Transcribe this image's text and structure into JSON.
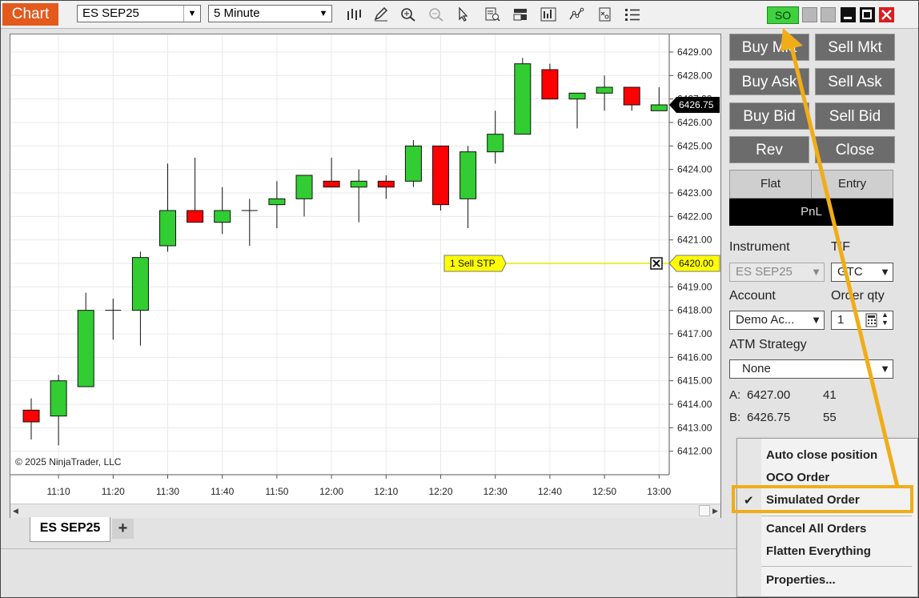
{
  "titlebar": {
    "chart_label": "Chart",
    "instrument": "ES SEP25",
    "interval": "5 Minute",
    "so_label": "SO"
  },
  "icons": [
    "bars-icon",
    "pencil-icon",
    "zoom-in-icon",
    "zoom-out-icon",
    "pointer-icon",
    "data-box-icon",
    "toggle-icon",
    "chart-trader-icon",
    "indicators-icon",
    "strategies-icon",
    "properties-icon",
    "minimize-icon",
    "maximize-icon",
    "close-icon"
  ],
  "chart_data": {
    "type": "candlestick",
    "x": [
      "11:05",
      "11:10",
      "11:15",
      "11:20",
      "11:25",
      "11:30",
      "11:35",
      "11:40",
      "11:45",
      "11:50",
      "11:55",
      "12:00",
      "12:05",
      "12:10",
      "12:15",
      "12:20",
      "12:25",
      "12:30",
      "12:35",
      "12:40",
      "12:45",
      "12:50",
      "12:55",
      "13:00"
    ],
    "x_ticks": [
      "11:10",
      "11:20",
      "11:30",
      "11:40",
      "11:50",
      "12:00",
      "12:10",
      "12:20",
      "12:30",
      "12:40",
      "12:50",
      "13:00"
    ],
    "y_ticks": [
      "6412.00",
      "6413.00",
      "6414.00",
      "6415.00",
      "6416.00",
      "6417.00",
      "6418.00",
      "6419.00",
      "6420.00",
      "6421.00",
      "6422.00",
      "6423.00",
      "6424.00",
      "6425.00",
      "6426.00",
      "6427.00",
      "6428.00",
      "6429.00"
    ],
    "ylim": [
      6411.0,
      6429.75
    ],
    "ohlc": [
      [
        6413.75,
        6414.25,
        6412.5,
        6413.25
      ],
      [
        6413.5,
        6415.25,
        6412.25,
        6415.0
      ],
      [
        6414.75,
        6418.75,
        6414.75,
        6418.0
      ],
      [
        6418.0,
        6418.5,
        6416.75,
        6418.0
      ],
      [
        6418.0,
        6420.5,
        6416.5,
        6420.25
      ],
      [
        6420.75,
        6424.25,
        6420.5,
        6422.25
      ],
      [
        6422.25,
        6424.5,
        6421.75,
        6421.75
      ],
      [
        6421.75,
        6423.25,
        6421.25,
        6422.25
      ],
      [
        6422.25,
        6422.75,
        6420.75,
        6422.25
      ],
      [
        6422.5,
        6423.5,
        6421.5,
        6422.75
      ],
      [
        6422.75,
        6423.75,
        6422.0,
        6423.75
      ],
      [
        6423.5,
        6424.5,
        6423.25,
        6423.25
      ],
      [
        6423.25,
        6424.0,
        6421.75,
        6423.5
      ],
      [
        6423.5,
        6423.75,
        6422.75,
        6423.25
      ],
      [
        6423.5,
        6425.25,
        6423.25,
        6425.0
      ],
      [
        6425.0,
        6425.0,
        6422.25,
        6422.5
      ],
      [
        6422.75,
        6425.0,
        6421.5,
        6424.75
      ],
      [
        6424.75,
        6426.5,
        6424.25,
        6425.5
      ],
      [
        6425.5,
        6428.75,
        6425.5,
        6428.5
      ],
      [
        6428.25,
        6428.5,
        6427.0,
        6427.0
      ],
      [
        6427.0,
        6427.25,
        6425.75,
        6427.25
      ],
      [
        6427.25,
        6428.0,
        6426.5,
        6427.5
      ],
      [
        6427.5,
        6427.5,
        6426.5,
        6426.75
      ],
      [
        6426.5,
        6427.5,
        6426.5,
        6426.75
      ]
    ],
    "last_price": "6426.75",
    "order_price": "6420.00",
    "order_label": "1  Sell STP",
    "copyright": "© 2025 NinjaTrader, LLC",
    "up_color": "#32cd32",
    "down_color": "#ff0000"
  },
  "tabs": {
    "active": "ES SEP25",
    "add": "+"
  },
  "trader": {
    "buttons": [
      "Buy Mkt",
      "Sell Mkt",
      "Buy Ask",
      "Sell Ask",
      "Buy Bid",
      "Sell Bid",
      "Rev",
      "Close"
    ],
    "flat": "Flat",
    "entry": "Entry",
    "pnl": "PnL",
    "instrument_label": "Instrument",
    "instrument_value": "ES SEP25",
    "tif_label": "TIF",
    "tif_value": "GTC",
    "account_label": "Account",
    "account_value": "Demo Ac...",
    "qty_label": "Order qty",
    "qty_value": "1",
    "atm_label": "ATM Strategy",
    "atm_value": "None",
    "ask_label": "A:",
    "ask_price": "6427.00",
    "ask_size": "41",
    "bid_label": "B:",
    "bid_price": "6426.75",
    "bid_size": "55"
  },
  "menu": {
    "items": [
      "Auto close position",
      "OCO Order",
      "Simulated Order",
      "Cancel All Orders",
      "Flatten Everything",
      "Properties..."
    ],
    "checked": "✔"
  },
  "colors": {
    "accent": "#e35a1c",
    "highlight": "#f0ad18",
    "so_green": "#3fd13f"
  }
}
